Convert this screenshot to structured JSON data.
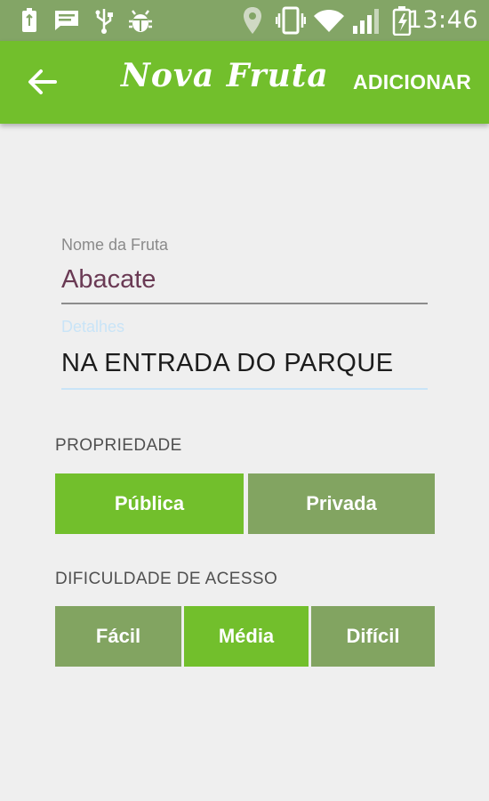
{
  "status_bar": {
    "time": "13:46",
    "icons": [
      "usb-battery-icon",
      "message-icon",
      "usb-icon",
      "android-debug-icon",
      "location-icon",
      "vibrate-icon",
      "wifi-icon",
      "signal-icon",
      "battery-charging-icon"
    ]
  },
  "app_bar": {
    "title": "Nova Fruta",
    "action_label": "ADICIONAR",
    "back_icon": "arrow-back-icon"
  },
  "form": {
    "name_label": "Nome da Fruta",
    "name_value": "Abacate",
    "details_label": "Detalhes",
    "details_value": "NA ENTRADA DO PARQUE"
  },
  "property": {
    "label": "PROPRIEDADE",
    "options": [
      "Pública",
      "Privada"
    ],
    "selected": "Pública"
  },
  "difficulty": {
    "label": "DIFICULDADE DE ACESSO",
    "options": [
      "Fácil",
      "Média",
      "Difícil"
    ],
    "selected": "Média"
  },
  "colors": {
    "accent": "#72bf2c",
    "unselected": "#82a461",
    "status_bar": "#83a566",
    "background": "#efefef"
  }
}
